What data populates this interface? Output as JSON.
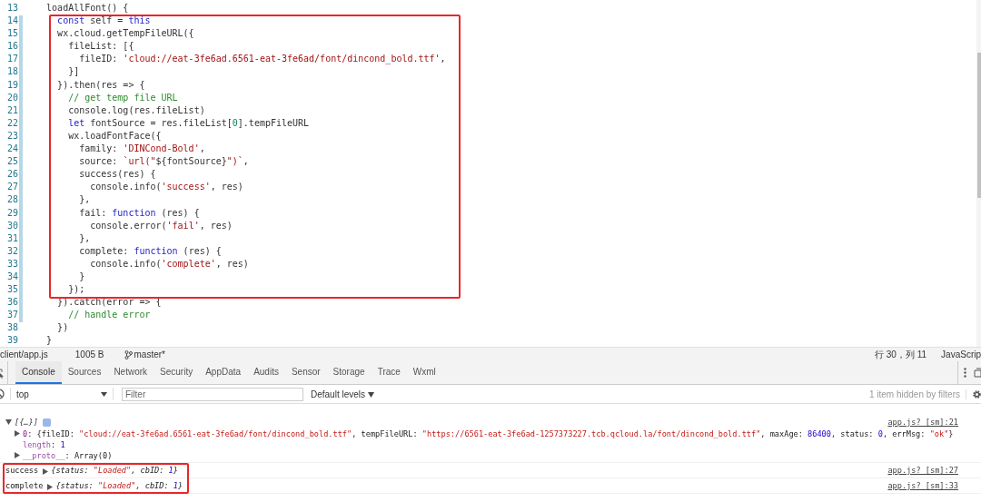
{
  "editor": {
    "lines": [
      {
        "number": "13",
        "modified": false,
        "tokens": [
          {
            "kind": "plain",
            "t": "    loadAllFont() {"
          }
        ]
      },
      {
        "number": "14",
        "modified": true,
        "tokens": [
          {
            "kind": "kw",
            "t": "      const"
          },
          {
            "kind": "plain",
            "t": " self = "
          },
          {
            "kind": "kw",
            "t": "this"
          }
        ]
      },
      {
        "number": "15",
        "modified": true,
        "tokens": [
          {
            "kind": "plain",
            "t": "      wx.cloud.getTempFileURL({"
          }
        ]
      },
      {
        "number": "16",
        "modified": true,
        "tokens": [
          {
            "kind": "plain",
            "t": "        fileList: [{"
          }
        ]
      },
      {
        "number": "17",
        "modified": true,
        "tokens": [
          {
            "kind": "plain",
            "t": "          fileID: "
          },
          {
            "kind": "str",
            "t": "'cloud://eat-3fe6ad.6561-eat-3fe6ad/font/dincond_bold.ttf'"
          },
          {
            "kind": "plain",
            "t": ","
          }
        ]
      },
      {
        "number": "18",
        "modified": true,
        "tokens": [
          {
            "kind": "plain",
            "t": "        }]"
          }
        ]
      },
      {
        "number": "19",
        "modified": true,
        "tokens": [
          {
            "kind": "plain",
            "t": "      }).then(res => {"
          }
        ]
      },
      {
        "number": "20",
        "modified": true,
        "tokens": [
          {
            "kind": "cm",
            "t": "        // get temp file URL"
          }
        ]
      },
      {
        "number": "21",
        "modified": true,
        "tokens": [
          {
            "kind": "plain",
            "t": "        console.log(res.fileList)"
          }
        ]
      },
      {
        "number": "22",
        "modified": true,
        "tokens": [
          {
            "kind": "kw",
            "t": "        let"
          },
          {
            "kind": "plain",
            "t": " fontSource = res.fileList["
          },
          {
            "kind": "num",
            "t": "0"
          },
          {
            "kind": "plain",
            "t": "].tempFileURL"
          }
        ]
      },
      {
        "number": "23",
        "modified": true,
        "tokens": [
          {
            "kind": "plain",
            "t": "        wx.loadFontFace({"
          }
        ]
      },
      {
        "number": "24",
        "modified": true,
        "tokens": [
          {
            "kind": "plain",
            "t": "          family: "
          },
          {
            "kind": "str",
            "t": "'DINCond-Bold'"
          },
          {
            "kind": "plain",
            "t": ","
          }
        ]
      },
      {
        "number": "25",
        "modified": true,
        "tokens": [
          {
            "kind": "plain",
            "t": "          source: "
          },
          {
            "kind": "str",
            "t": "`url(\""
          },
          {
            "kind": "plain",
            "t": "${fontSource}"
          },
          {
            "kind": "str",
            "t": "\")`"
          },
          {
            "kind": "plain",
            "t": ","
          }
        ]
      },
      {
        "number": "26",
        "modified": true,
        "tokens": [
          {
            "kind": "plain",
            "t": "          success(res) {"
          }
        ]
      },
      {
        "number": "27",
        "modified": true,
        "tokens": [
          {
            "kind": "plain",
            "t": "            console.info("
          },
          {
            "kind": "str",
            "t": "'success'"
          },
          {
            "kind": "plain",
            "t": ", res)"
          }
        ]
      },
      {
        "number": "28",
        "modified": true,
        "tokens": [
          {
            "kind": "plain",
            "t": "          },"
          }
        ]
      },
      {
        "number": "29",
        "modified": true,
        "tokens": [
          {
            "kind": "plain",
            "t": "          fail: "
          },
          {
            "kind": "kw",
            "t": "function"
          },
          {
            "kind": "plain",
            "t": " (res) {"
          }
        ]
      },
      {
        "number": "30",
        "modified": true,
        "tokens": [
          {
            "kind": "plain",
            "t": "            console.error("
          },
          {
            "kind": "str",
            "t": "'fail'"
          },
          {
            "kind": "plain",
            "t": ", res)"
          }
        ]
      },
      {
        "number": "31",
        "modified": true,
        "tokens": [
          {
            "kind": "plain",
            "t": "          },"
          }
        ]
      },
      {
        "number": "32",
        "modified": true,
        "tokens": [
          {
            "kind": "plain",
            "t": "          complete: "
          },
          {
            "kind": "kw",
            "t": "function"
          },
          {
            "kind": "plain",
            "t": " (res) {"
          }
        ]
      },
      {
        "number": "33",
        "modified": true,
        "tokens": [
          {
            "kind": "plain",
            "t": "            console.info("
          },
          {
            "kind": "str",
            "t": "'complete'"
          },
          {
            "kind": "plain",
            "t": ", res)"
          }
        ]
      },
      {
        "number": "34",
        "modified": true,
        "tokens": [
          {
            "kind": "plain",
            "t": "          }"
          }
        ]
      },
      {
        "number": "35",
        "modified": true,
        "tokens": [
          {
            "kind": "plain",
            "t": "        });"
          }
        ]
      },
      {
        "number": "36",
        "modified": true,
        "tokens": [
          {
            "kind": "plain",
            "t": "      }).catch(error => {"
          }
        ]
      },
      {
        "number": "37",
        "modified": true,
        "tokens": [
          {
            "kind": "cm",
            "t": "        // handle error"
          }
        ]
      },
      {
        "number": "38",
        "modified": false,
        "tokens": [
          {
            "kind": "plain",
            "t": "      })"
          }
        ]
      },
      {
        "number": "39",
        "modified": false,
        "tokens": [
          {
            "kind": "plain",
            "t": "    }"
          }
        ]
      }
    ]
  },
  "status_bar": {
    "file": "client/app.js",
    "size": "1005 B",
    "branch": "master*",
    "position": "行 30，列 11",
    "language": "JavaScrip"
  },
  "devtools": {
    "tabs": [
      {
        "label": "Console",
        "selected": true
      },
      {
        "label": "Sources",
        "selected": false
      },
      {
        "label": "Network",
        "selected": false
      },
      {
        "label": "Security",
        "selected": false
      },
      {
        "label": "AppData",
        "selected": false
      },
      {
        "label": "Audits",
        "selected": false
      },
      {
        "label": "Sensor",
        "selected": false
      },
      {
        "label": "Storage",
        "selected": false
      },
      {
        "label": "Trace",
        "selected": false
      },
      {
        "label": "Wxml",
        "selected": false
      }
    ],
    "context": "top",
    "filter": {
      "placeholder": "Filter"
    },
    "levels": "Default levels",
    "hidden_note": "1 item hidden by filters",
    "messages": [
      {
        "kind": "group",
        "expanded": true,
        "label": "[{…}]",
        "source": "app.js? [sm]:21",
        "children": [
          {
            "kind": "entry",
            "expanded": false,
            "tokens": [
              {
                "kind": "key",
                "t": "0"
              },
              {
                "kind": "plain",
                "t": ": {fileID: "
              },
              {
                "kind": "str",
                "t": "\"cloud://eat-3fe6ad.6561-eat-3fe6ad/font/dincond_bold.ttf\""
              },
              {
                "kind": "plain",
                "t": ", tempFileURL: "
              },
              {
                "kind": "str",
                "t": "\"https://6561-eat-3fe6ad-1257373227.tcb.qcloud.la/font/dincond_bold.ttf\""
              },
              {
                "kind": "plain",
                "t": ", maxAge: "
              },
              {
                "kind": "num",
                "t": "86400"
              },
              {
                "kind": "plain",
                "t": ", status: "
              },
              {
                "kind": "num",
                "t": "0"
              },
              {
                "kind": "plain",
                "t": ", errMsg: "
              },
              {
                "kind": "str",
                "t": "\"ok\""
              },
              {
                "kind": "plain",
                "t": "}"
              }
            ]
          },
          {
            "kind": "prop",
            "tokens": [
              {
                "kind": "pkey",
                "t": "length"
              },
              {
                "kind": "plain",
                "t": ": "
              },
              {
                "kind": "num",
                "t": "1"
              }
            ]
          },
          {
            "kind": "entry",
            "expanded": false,
            "tokens": [
              {
                "kind": "pkey",
                "t": "__proto__"
              },
              {
                "kind": "plain",
                "t": ": Array(0)"
              }
            ]
          }
        ]
      },
      {
        "kind": "log",
        "label": "success",
        "expanded": false,
        "source": "app.js? [sm]:27",
        "tokens": [
          {
            "kind": "plain",
            "t": "{status: "
          },
          {
            "kind": "str",
            "t": "\"Loaded\""
          },
          {
            "kind": "plain",
            "t": ", cbID: "
          },
          {
            "kind": "num",
            "t": "1"
          },
          {
            "kind": "plain",
            "t": "}"
          }
        ]
      },
      {
        "kind": "log",
        "label": "complete",
        "expanded": false,
        "source": "app.js? [sm]:33",
        "tokens": [
          {
            "kind": "plain",
            "t": "{status: "
          },
          {
            "kind": "str",
            "t": "\"Loaded\""
          },
          {
            "kind": "plain",
            "t": ", cbID: "
          },
          {
            "kind": "num",
            "t": "1"
          },
          {
            "kind": "plain",
            "t": "}"
          }
        ]
      }
    ]
  }
}
